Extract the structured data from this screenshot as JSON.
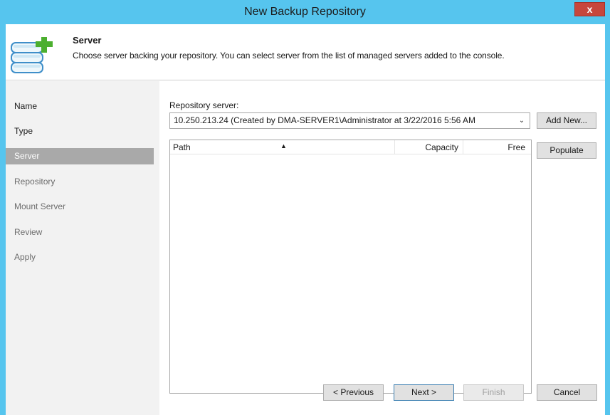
{
  "window": {
    "title": "New Backup Repository",
    "close_label": "x"
  },
  "header": {
    "title": "Server",
    "description": "Choose server backing your repository. You can select server from the list of managed servers added to the console.",
    "icon": "database-add-icon"
  },
  "steps": [
    {
      "label": "Name",
      "state": "done"
    },
    {
      "label": "Type",
      "state": "done"
    },
    {
      "label": "Server",
      "state": "active"
    },
    {
      "label": "Repository",
      "state": "inactive"
    },
    {
      "label": "Mount Server",
      "state": "inactive"
    },
    {
      "label": "Review",
      "state": "inactive"
    },
    {
      "label": "Apply",
      "state": "inactive"
    }
  ],
  "form": {
    "repository_label": "Repository server:",
    "repository_value": "10.250.213.24 (Created by DMA-SERVER1\\Administrator at 3/22/2016 5:56 AM",
    "add_new_label": "Add New...",
    "populate_label": "Populate"
  },
  "table": {
    "columns": [
      "Path",
      "Capacity",
      "Free"
    ],
    "rows": []
  },
  "footer": {
    "previous_label": "< Previous",
    "next_label": "Next >",
    "finish_label": "Finish",
    "cancel_label": "Cancel"
  },
  "colors": {
    "titlebar": "#56c5ee",
    "close_button": "#c7463c",
    "active_step": "#a9a9a9",
    "icon_green": "#4caf2f"
  }
}
